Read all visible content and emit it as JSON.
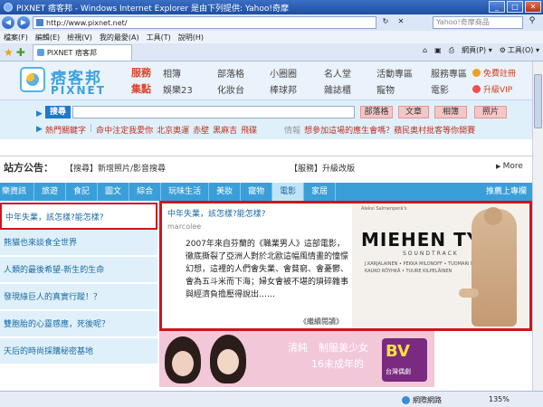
{
  "browser": {
    "window_title": "PIXNET 痞客邦 - Windows Internet Explorer 是由下列提供: Yahoo!奇摩",
    "address": "http://www.pixnet.net/",
    "search_placeholder": "Yahoo!奇摩商品",
    "menu": [
      "檔案(F)",
      "編輯(E)",
      "檢視(V)",
      "我的最愛(A)",
      "工具(T)",
      "說明(H)"
    ],
    "tab_label": "PIXNET 痞客邦",
    "commands": [
      "網頁(P) ▾",
      "工具(O) ▾"
    ],
    "status_zone": "網際網路",
    "zoom": "135%"
  },
  "header": {
    "logo_cn": "痞客邦",
    "logo_en": "PIXNET",
    "nav_head_1": "服務",
    "nav_head_2": "集點",
    "row1": [
      "相簿",
      "部落格",
      "小圈圈",
      "名人堂",
      "活動專區",
      "服務專區"
    ],
    "row2": [
      "娛樂23",
      "化妝台",
      "棒球邦",
      "雜誌櫃",
      "寵物",
      "電影"
    ],
    "extra1": "免費註冊",
    "extra2": "升級VIP"
  },
  "search": {
    "label": "搜尋",
    "buttons": [
      "部落格",
      "文章",
      "相簿",
      "照片"
    ],
    "hot_label": "熱門關鍵字",
    "hot_items": [
      "命中注定我愛你",
      "北京奧運",
      "赤壁",
      "黑麻吉",
      "飛碟"
    ],
    "tail_gray": "情報",
    "tail_red": "想參加這場的應生會嗎？蘋民奧村批客等你開賽"
  },
  "announcement": {
    "title": "站方公告：",
    "item1": "【搜尋】新增照片/影音搜尋",
    "item2": "【服務】升級改版",
    "more": "More"
  },
  "categories": [
    "樂資訊",
    "旅遊",
    "食記",
    "圖文",
    "綜合",
    "玩味生活",
    "美妝",
    "寵物",
    "電影",
    "家居"
  ],
  "category_active": "電影",
  "category_right": "推薦上專欄",
  "left_list": [
    "中年失業，該怎樣?能怎樣?",
    "熊貓也來談食全世界",
    "人類的最後希望-新生的生命",
    "發現綠巨人的真實行蹤！？",
    "雙胞胎的心靈感應，死後呢？",
    "天后的時尚採購秘密基地"
  ],
  "article": {
    "title": "中年失業，該怎樣?能怎樣?",
    "author": "marcolee",
    "body": "2007年來自芬蘭的《職業男人》這部電影，徹底撕裂了亞洲人對於北歐這幅風情畫的憧憬幻想，這裡的人們會失業、會貧窮、會憂鬱、會為五斗米而下海；婦女會被不堪的瑣碎雜事與經濟負擔壓得說出……",
    "more": "《繼續閱讀》"
  },
  "poster": {
    "credit": "Aleksi Salmenperä's",
    "title": "MIEHEN TYÖ",
    "subtitle": "SOUNDTRACK",
    "cast1": "J.KARJALAINEN • PEKKA MILONOFF • TUOMARI NURMIO",
    "cast2": "KAUKO RÖYHKÄ • TUURE KILPELÄINEN"
  },
  "banner": {
    "text1": "清純",
    "text2": "制服美少女",
    "text3": "16未成年的",
    "logo_big": "BV",
    "logo_small": "台灣偶劇"
  }
}
